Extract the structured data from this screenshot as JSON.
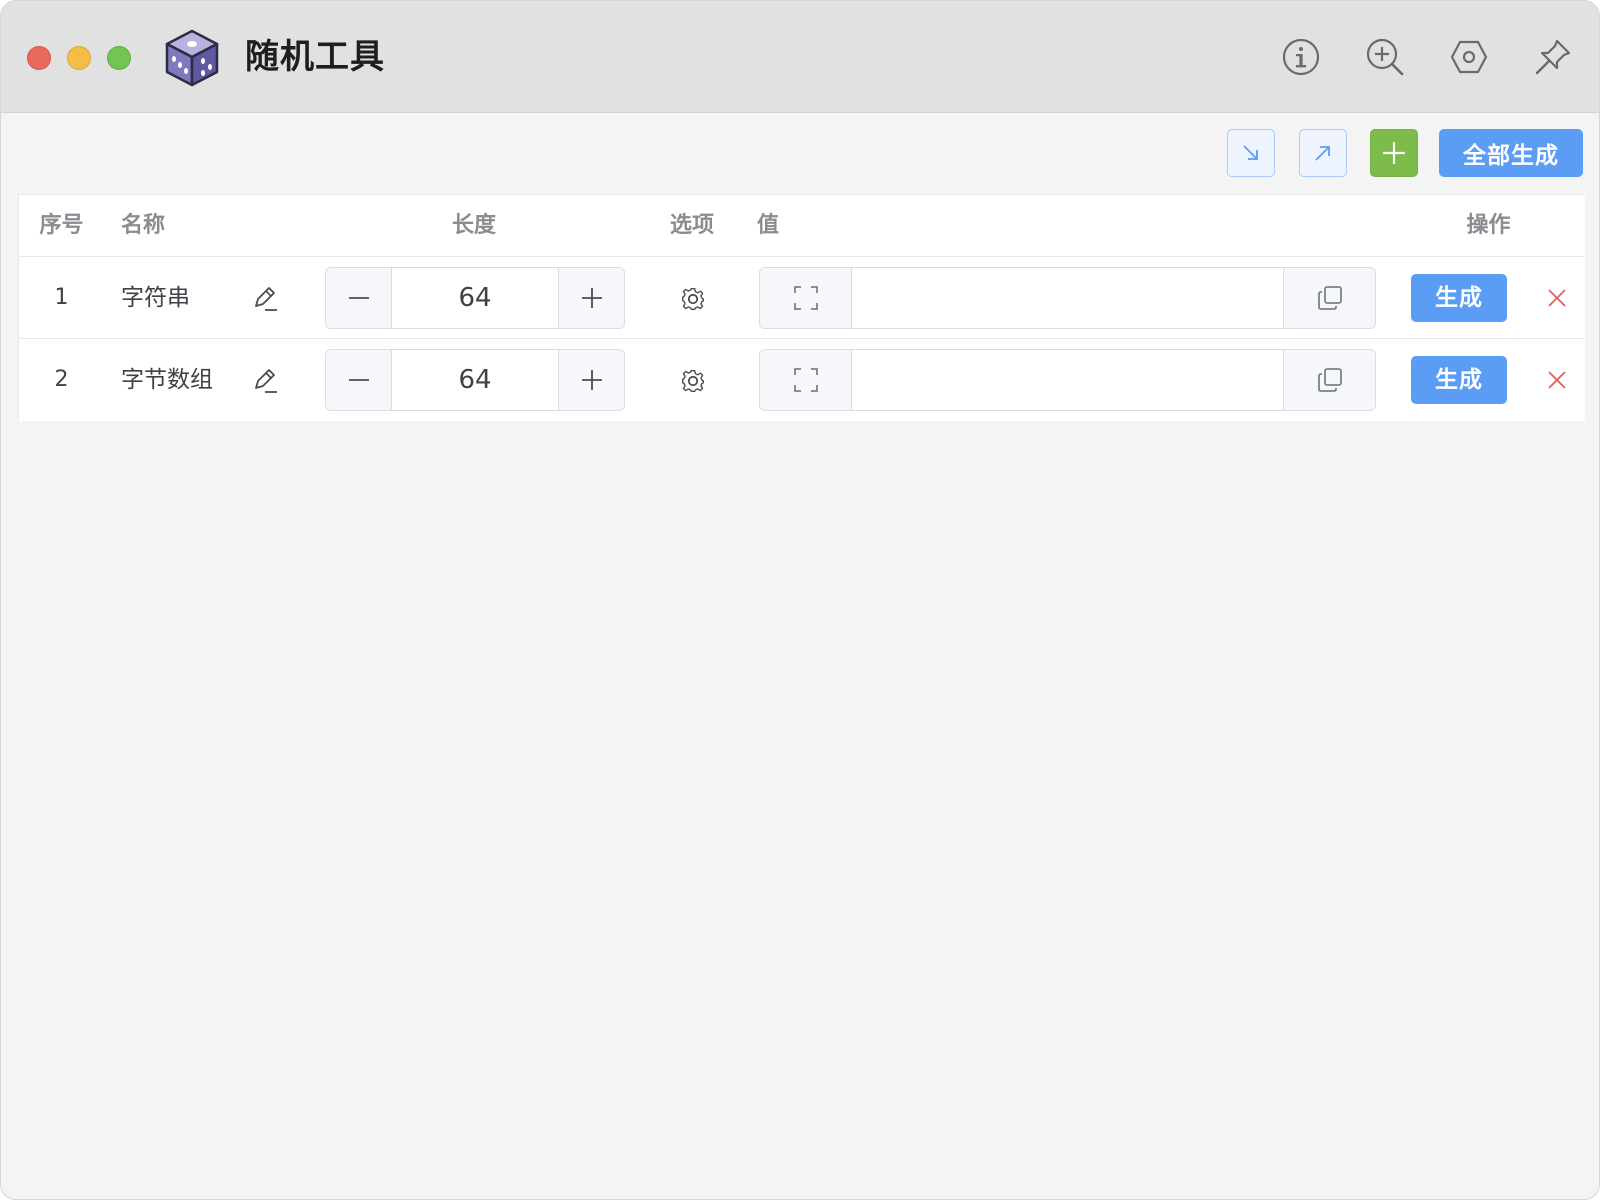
{
  "window": {
    "title": "随机工具",
    "traffic_lights": {
      "close_color": "#e8695c",
      "minimize_color": "#f2be45",
      "maximize_color": "#72c454"
    },
    "title_icons": [
      "info-icon",
      "zoom-in-icon",
      "hexagon-settings-icon",
      "pin-icon"
    ]
  },
  "toolbar": {
    "collapse_icon": "arrow-down-right-icon",
    "expand_icon": "arrow-up-right-icon",
    "add_icon": "plus-icon",
    "generate_all_label": "全部生成"
  },
  "table": {
    "headers": {
      "index": "序号",
      "name": "名称",
      "length": "长度",
      "options": "选项",
      "value": "值",
      "actions": "操作"
    },
    "rows": [
      {
        "index": "1",
        "name": "字符串",
        "length": "64",
        "value": "",
        "generate_label": "生成"
      },
      {
        "index": "2",
        "name": "字节数组",
        "length": "64",
        "value": "",
        "generate_label": "生成"
      }
    ]
  },
  "colors": {
    "primary": "#5b9cf4",
    "success": "#7dbb4b",
    "danger": "#e0625a",
    "titlebar": "#e1e1e1",
    "background": "#f4f4f4"
  }
}
